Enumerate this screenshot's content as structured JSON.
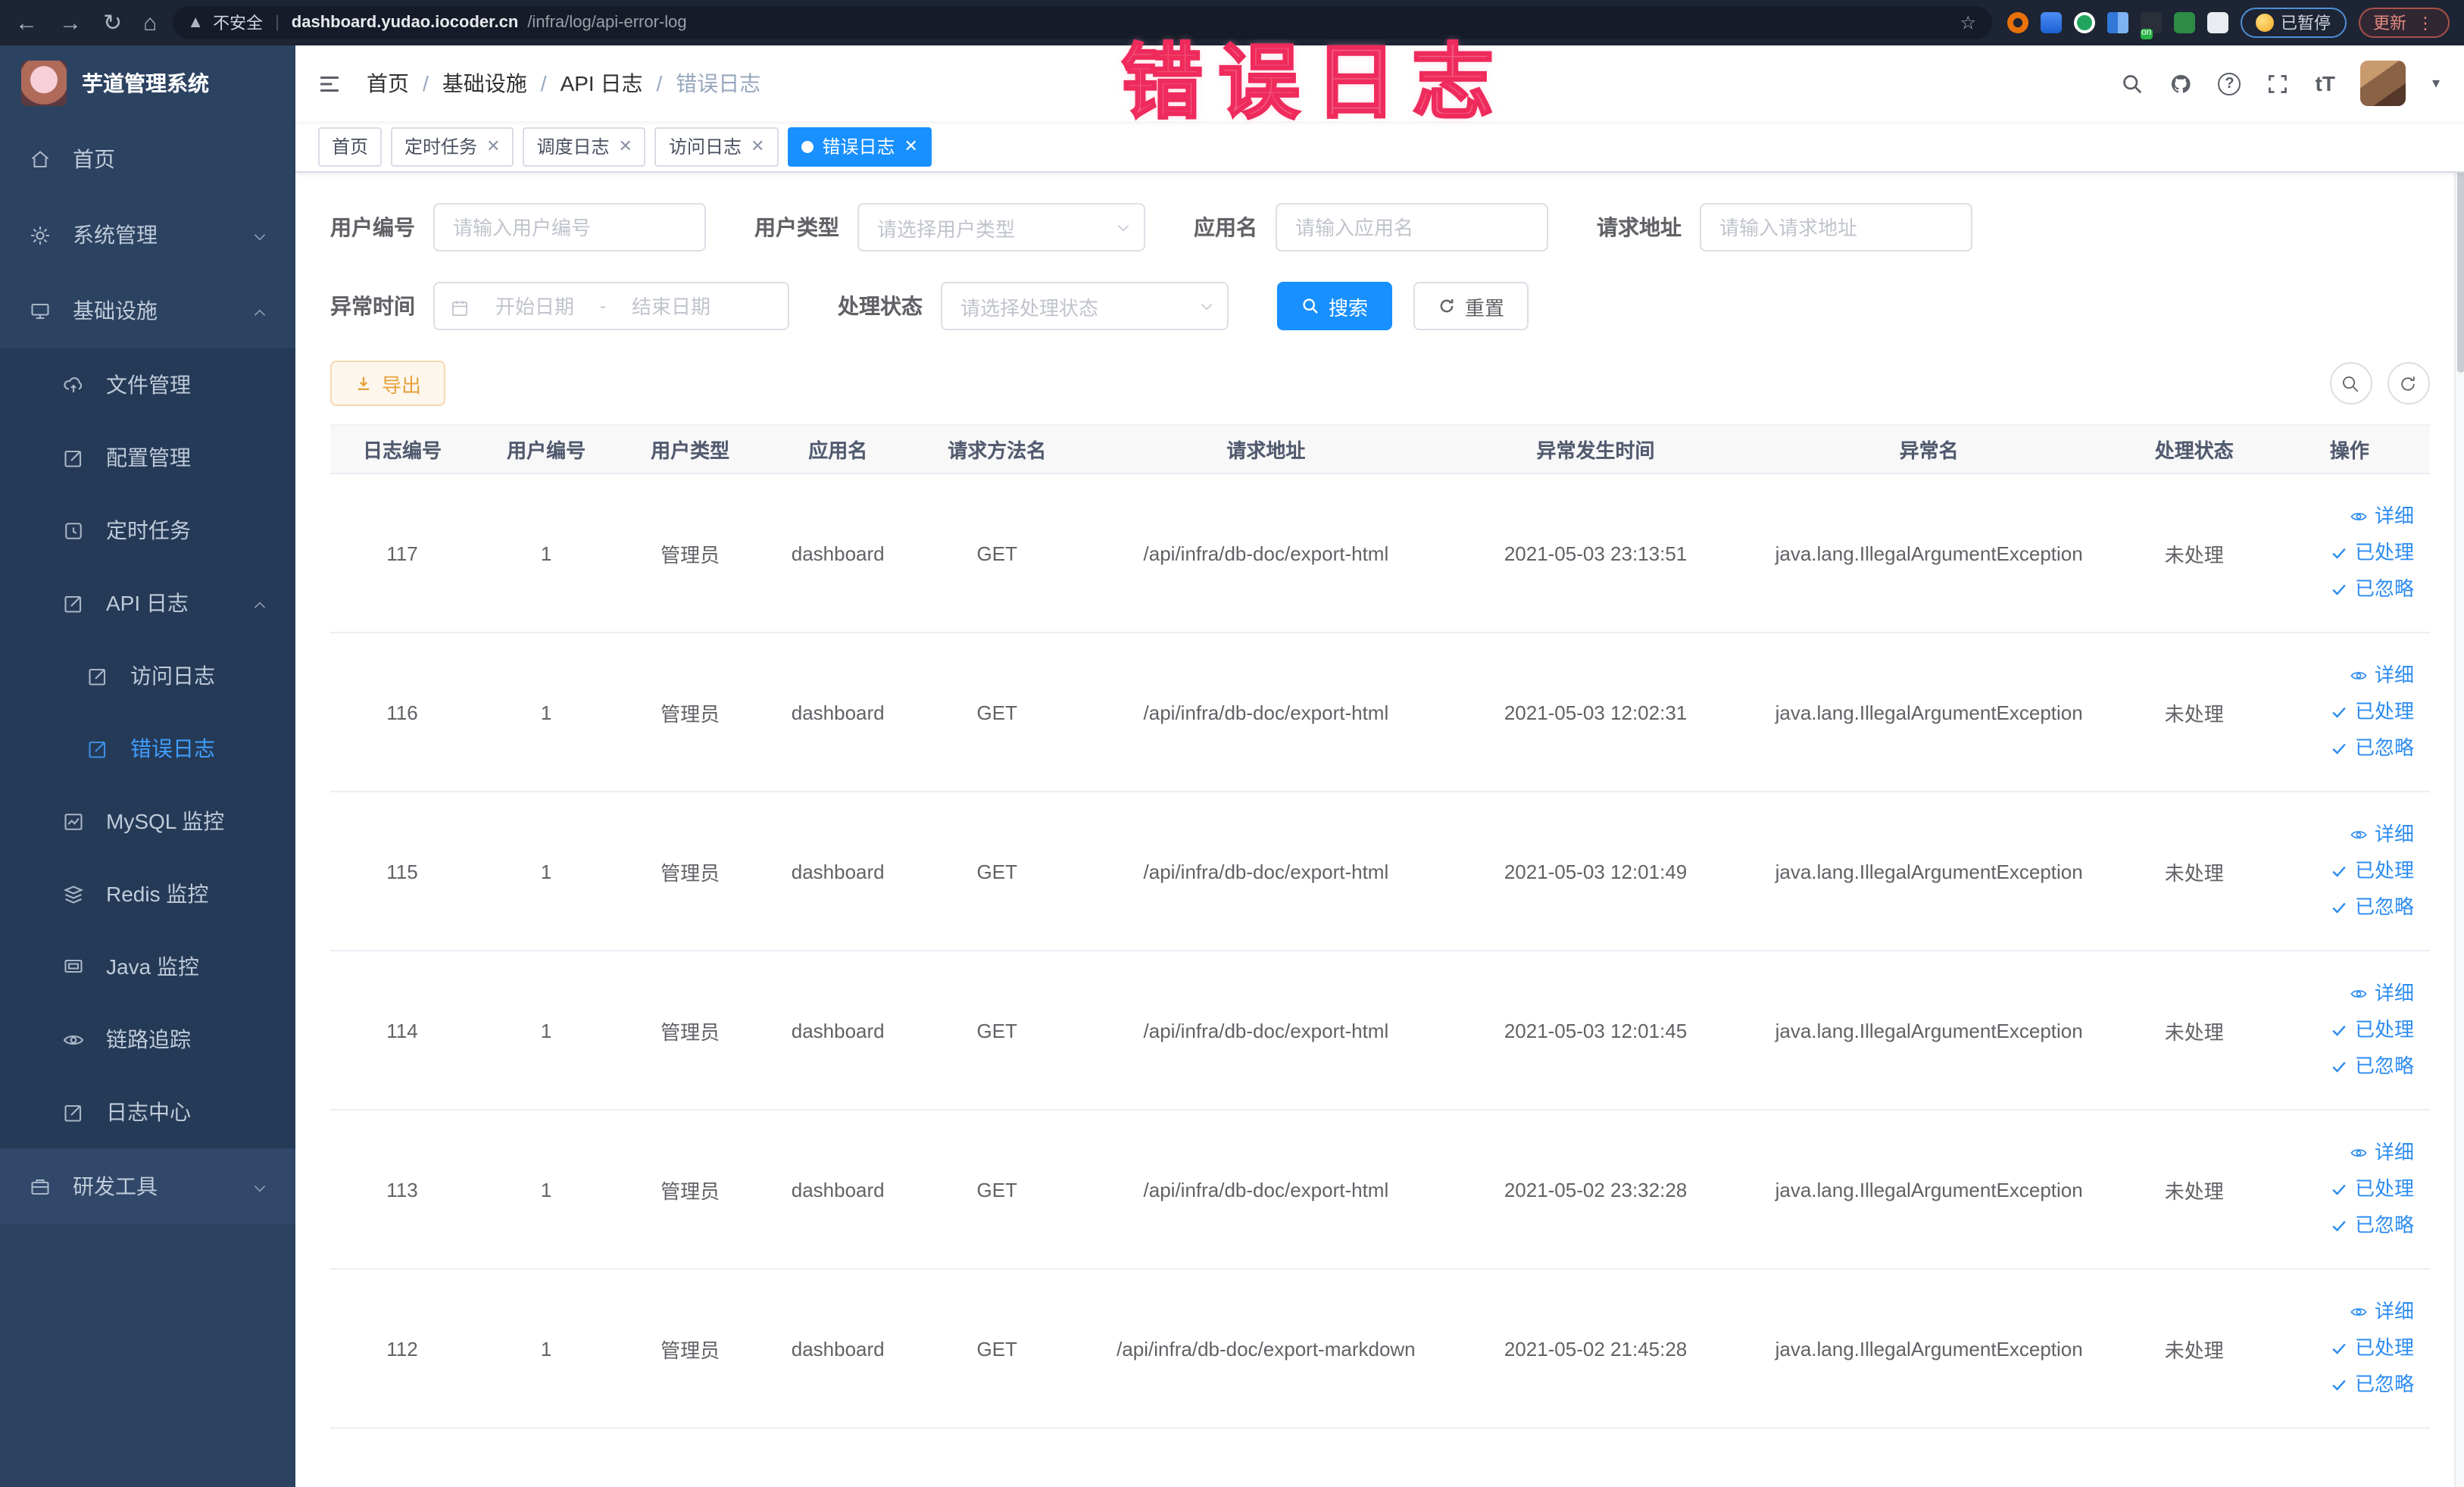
{
  "colors": {
    "primary": "#1890ff",
    "link": "#2d8cf0",
    "warning": "#e6a23c",
    "sidebar_bg": "#2c4261",
    "annotation": "#f2486e"
  },
  "overlay": {
    "title": "错误日志"
  },
  "browser": {
    "security_label": "不安全",
    "url_host": "dashboard.yudao.iocoder.cn",
    "url_path": "/infra/log/api-error-log",
    "on_badge": "on",
    "paused_badge": "已暂停",
    "update_button": "更新"
  },
  "sidebar": {
    "app_title": "芋道管理系统",
    "items": [
      {
        "label": "首页"
      },
      {
        "label": "系统管理"
      },
      {
        "label": "基础设施"
      },
      {
        "label": "文件管理"
      },
      {
        "label": "配置管理"
      },
      {
        "label": "定时任务"
      },
      {
        "label": "API 日志"
      },
      {
        "label": "访问日志"
      },
      {
        "label": "错误日志"
      },
      {
        "label": "MySQL 监控"
      },
      {
        "label": "Redis 监控"
      },
      {
        "label": "Java 监控"
      },
      {
        "label": "链路追踪"
      },
      {
        "label": "日志中心"
      },
      {
        "label": "研发工具"
      }
    ]
  },
  "breadcrumb": {
    "items": [
      "首页",
      "基础设施",
      "API 日志",
      "错误日志"
    ]
  },
  "tabs": [
    {
      "label": "首页"
    },
    {
      "label": "定时任务"
    },
    {
      "label": "调度日志"
    },
    {
      "label": "访问日志"
    },
    {
      "label": "错误日志"
    }
  ],
  "filters": {
    "user_id": {
      "label": "用户编号",
      "placeholder": "请输入用户编号"
    },
    "user_type": {
      "label": "用户类型",
      "placeholder": "请选择用户类型"
    },
    "app_name": {
      "label": "应用名",
      "placeholder": "请输入应用名"
    },
    "request_url": {
      "label": "请求地址",
      "placeholder": "请输入请求地址"
    },
    "exception_time": {
      "label": "异常时间",
      "start_placeholder": "开始日期",
      "separator": "-",
      "end_placeholder": "结束日期"
    },
    "status": {
      "label": "处理状态",
      "placeholder": "请选择处理状态"
    },
    "search_button": "搜索",
    "reset_button": "重置"
  },
  "toolbar": {
    "export_button": "导出"
  },
  "table": {
    "columns": [
      "日志编号",
      "用户编号",
      "用户类型",
      "应用名",
      "请求方法名",
      "请求地址",
      "异常发生时间",
      "异常名",
      "处理状态",
      "操作"
    ],
    "action_labels": {
      "detail": "详细",
      "processed": "已处理",
      "ignored": "已忽略"
    },
    "rows": [
      {
        "log_id": "117",
        "user_id": "1",
        "user_type": "管理员",
        "app_name": "dashboard",
        "method": "GET",
        "url": "/api/infra/db-doc/export-html",
        "time": "2021-05-03 23:13:51",
        "exception": "java.lang.IllegalArgumentException",
        "status": "未处理"
      },
      {
        "log_id": "116",
        "user_id": "1",
        "user_type": "管理员",
        "app_name": "dashboard",
        "method": "GET",
        "url": "/api/infra/db-doc/export-html",
        "time": "2021-05-03 12:02:31",
        "exception": "java.lang.IllegalArgumentException",
        "status": "未处理"
      },
      {
        "log_id": "115",
        "user_id": "1",
        "user_type": "管理员",
        "app_name": "dashboard",
        "method": "GET",
        "url": "/api/infra/db-doc/export-html",
        "time": "2021-05-03 12:01:49",
        "exception": "java.lang.IllegalArgumentException",
        "status": "未处理"
      },
      {
        "log_id": "114",
        "user_id": "1",
        "user_type": "管理员",
        "app_name": "dashboard",
        "method": "GET",
        "url": "/api/infra/db-doc/export-html",
        "time": "2021-05-03 12:01:45",
        "exception": "java.lang.IllegalArgumentException",
        "status": "未处理"
      },
      {
        "log_id": "113",
        "user_id": "1",
        "user_type": "管理员",
        "app_name": "dashboard",
        "method": "GET",
        "url": "/api/infra/db-doc/export-html",
        "time": "2021-05-02 23:32:28",
        "exception": "java.lang.IllegalArgumentException",
        "status": "未处理"
      },
      {
        "log_id": "112",
        "user_id": "1",
        "user_type": "管理员",
        "app_name": "dashboard",
        "method": "GET",
        "url": "/api/infra/db-doc/export-markdown",
        "time": "2021-05-02 21:45:28",
        "exception": "java.lang.IllegalArgumentException",
        "status": "未处理"
      }
    ]
  }
}
